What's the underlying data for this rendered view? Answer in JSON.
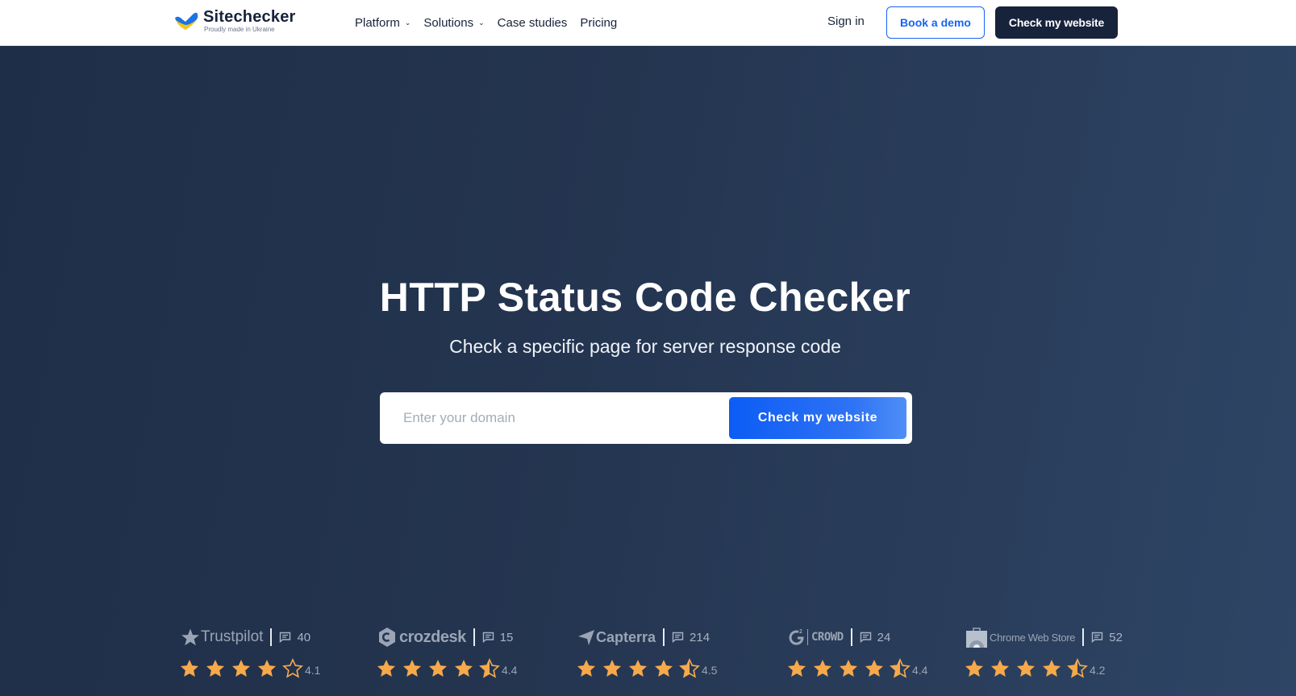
{
  "header": {
    "logo": {
      "name": "Sitechecker",
      "tagline": "Proudly made in Ukraine"
    },
    "nav": [
      {
        "label": "Platform",
        "has_dropdown": true
      },
      {
        "label": "Solutions",
        "has_dropdown": true
      },
      {
        "label": "Case studies",
        "has_dropdown": false
      },
      {
        "label": "Pricing",
        "has_dropdown": false
      }
    ],
    "sign_in": "Sign in",
    "book_demo": "Book a demo",
    "check_website": "Check my website"
  },
  "hero": {
    "title": "HTTP Status Code Checker",
    "subtitle": "Check a specific page for server response code",
    "search": {
      "placeholder": "Enter your domain",
      "value": "",
      "button": "Check my website"
    }
  },
  "ratings": [
    {
      "platform": "Trustpilot",
      "icon": "trustpilot-star-icon",
      "reviews": "40",
      "score": "4.1",
      "stars": 4.0
    },
    {
      "platform": "crozdesk",
      "icon": "crozdesk-icon",
      "reviews": "15",
      "score": "4.4",
      "stars": 4.5
    },
    {
      "platform": "Capterra",
      "icon": "capterra-arrow-icon",
      "reviews": "214",
      "score": "4.5",
      "stars": 4.5
    },
    {
      "platform": "CROWD",
      "icon": "g2-icon",
      "reviews": "24",
      "score": "4.4",
      "stars": 4.5
    },
    {
      "platform": "Chrome Web Store",
      "icon": "chrome-web-store-icon",
      "reviews": "52",
      "score": "4.2",
      "stars": 4.5
    }
  ],
  "colors": {
    "brand_dark": "#17233b",
    "accent_blue": "#1664f5",
    "star": "#f7a94a",
    "hero_bg": "#243550"
  }
}
